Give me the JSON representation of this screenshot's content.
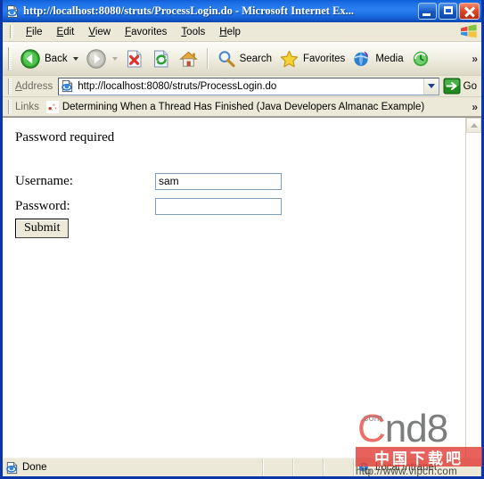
{
  "window": {
    "title": "http://localhost:8080/struts/ProcessLogin.do - Microsoft Internet Ex...",
    "icon": "ie-document-icon",
    "buttons": {
      "minimize": "Minimize",
      "maximize": "Maximize",
      "close": "Close"
    }
  },
  "menubar": {
    "items": [
      {
        "label": "File",
        "pre": "F",
        "mid": "ile"
      },
      {
        "label": "Edit",
        "pre": "E",
        "mid": "dit"
      },
      {
        "label": "View",
        "pre": "V",
        "mid": "iew"
      },
      {
        "label": "Favorites",
        "pre": "F",
        "mid": "avorites"
      },
      {
        "label": "Tools",
        "pre": "T",
        "mid": "ools"
      },
      {
        "label": "Help",
        "pre": "H",
        "mid": "elp"
      }
    ],
    "brand_icon": "windows-flag-icon"
  },
  "toolbar": {
    "back_label": "Back",
    "forward_label": "",
    "stop_label": "",
    "refresh_label": "",
    "home_label": "",
    "search_label": "Search",
    "favorites_label": "Favorites",
    "media_label": "Media",
    "history_label": "",
    "overflow_label": "»"
  },
  "addressbar": {
    "label": "Address",
    "url": "http://localhost:8080/struts/ProcessLogin.do",
    "go_label": "Go",
    "site_icon": "ie-page-icon"
  },
  "linksbar": {
    "label": "Links",
    "overflow_label": "»",
    "items": [
      {
        "label": "Determining When a Thread Has Finished (Java Developers Almanac Example)",
        "icon": "link-favicon"
      }
    ]
  },
  "page": {
    "message": "Password required",
    "fields": [
      {
        "label": "Username:",
        "value": "sam",
        "type": "text",
        "name": "username"
      },
      {
        "label": "Password:",
        "value": "",
        "type": "password",
        "name": "password"
      }
    ],
    "submit_label": "Submit"
  },
  "scrollbar": {
    "up_icon": "chevron-up-icon"
  },
  "statusbar": {
    "text": "Done",
    "icon": "ie-page-icon",
    "zone": "Local intranet",
    "zone_icon": "globe-network-icon"
  },
  "watermark": {
    "brand_c": "C",
    "brand_rest": "nd8",
    "tld": ".com",
    "band_text": "中国下载吧",
    "url": "http://www.vipcn.com"
  },
  "colors": {
    "title_blue": "#0b36a8",
    "face": "#ece9d8",
    "accent_red": "#e23b34",
    "field_border": "#7f9db9"
  }
}
